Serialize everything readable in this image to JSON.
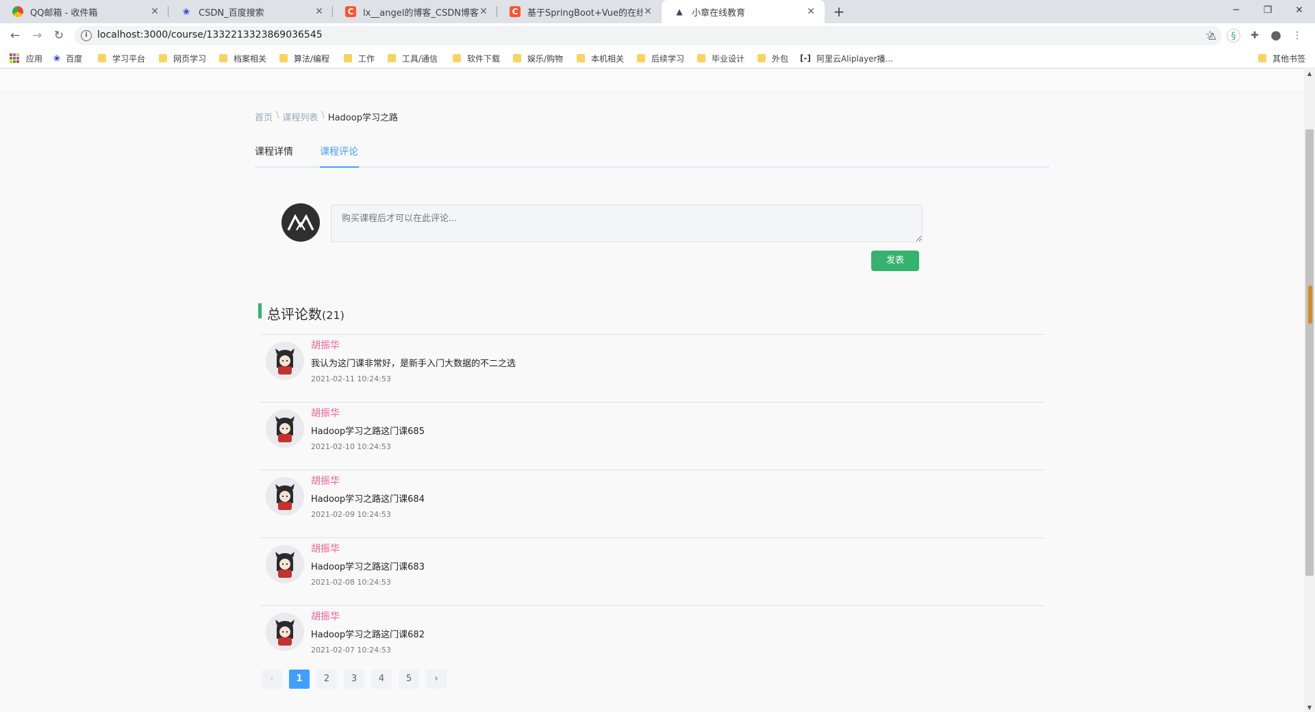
{
  "browser": {
    "tabs": [
      {
        "title": "QQ邮箱 - 收件箱",
        "icon": "qq-mail-icon"
      },
      {
        "title": "CSDN_百度搜索",
        "icon": "baidu-paw-icon"
      },
      {
        "title": "lx__angel的博客_CSDN博客-JAVA",
        "icon": "csdn-icon"
      },
      {
        "title": "基于SpringBoot+Vue的在线教育",
        "icon": "csdn-icon"
      },
      {
        "title": "小章在线教育",
        "icon": "vue-logo-icon"
      }
    ],
    "close_glyph": "✕",
    "url": "localhost:3000/course/1332213323869036545",
    "bookmarks": [
      "应用",
      "百度",
      "学习平台",
      "网页学习",
      "档案相关",
      "算法/编程",
      "工作",
      "工具/通信",
      "软件下载",
      "娱乐/购物",
      "本机相关",
      "后续学习",
      "毕业设计",
      "外包",
      "阿里云Aliplayer播...",
      "其他书签"
    ]
  },
  "breadcrumb": {
    "home": "首页",
    "list": "课程列表",
    "current": "Hadoop学习之路",
    "sep": "\\"
  },
  "course_tabs": {
    "detail": "课程详情",
    "comments": "课程评论"
  },
  "comment_form": {
    "placeholder": "购买课程后才可以在此评论...",
    "submit": "发表"
  },
  "comments_summary": {
    "label": "总评论数",
    "count": "(21)"
  },
  "comments": [
    {
      "user": "胡振华",
      "content": "我认为这门课非常好，是新手入门大数据的不二之选",
      "time": "2021-02-11 10:24:53"
    },
    {
      "user": "胡振华",
      "content": "Hadoop学习之路这门课685",
      "time": "2021-02-10 10:24:53"
    },
    {
      "user": "胡振华",
      "content": "Hadoop学习之路这门课684",
      "time": "2021-02-09 10:24:53"
    },
    {
      "user": "胡振华",
      "content": "Hadoop学习之路这门课683",
      "time": "2021-02-08 10:24:53"
    },
    {
      "user": "胡振华",
      "content": "Hadoop学习之路这门课682",
      "time": "2021-02-07 10:24:53"
    }
  ],
  "pagination": {
    "prev": "‹",
    "next": "›",
    "pages": [
      "1",
      "2",
      "3",
      "4",
      "5"
    ],
    "current": "1"
  },
  "colors": {
    "accent": "#409eff",
    "publish": "#36b26f",
    "username": "#ee5e8f"
  }
}
